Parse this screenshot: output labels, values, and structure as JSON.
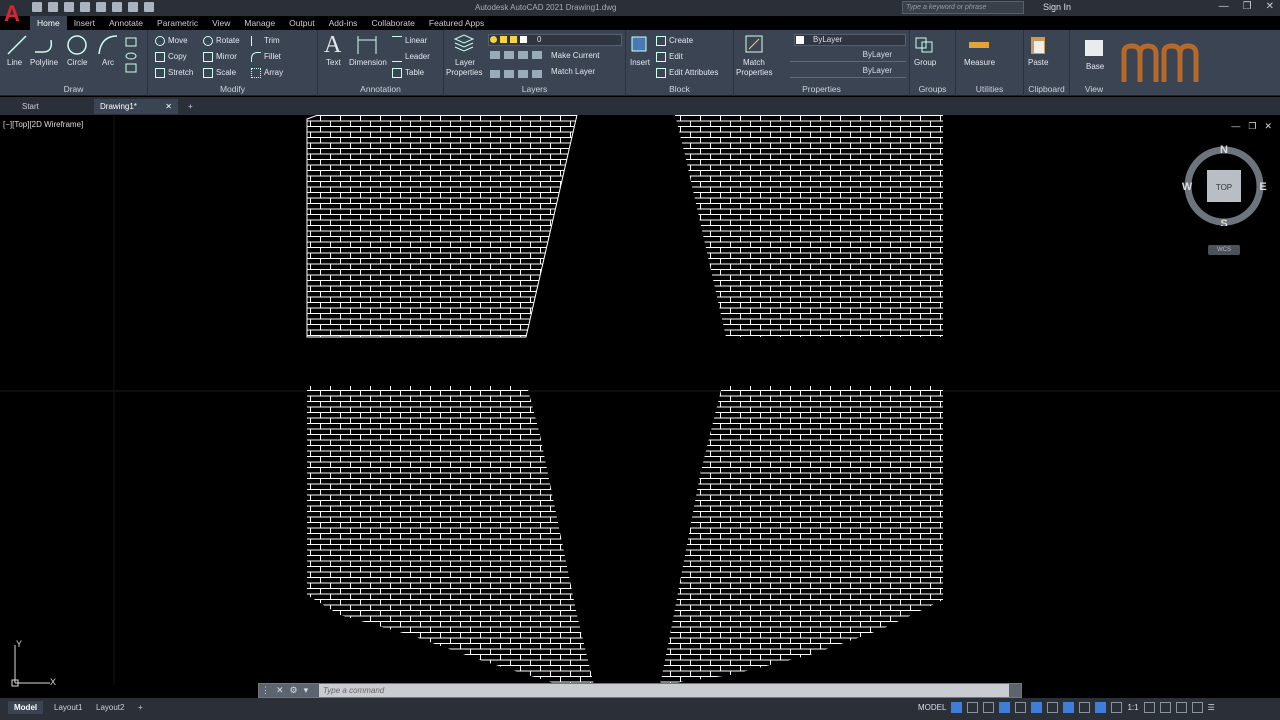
{
  "app": {
    "title": "Autodesk AutoCAD 2021    Drawing1.dwg",
    "search_placeholder": "Type a keyword or phrase",
    "signin": "Sign In",
    "logo_letter": "A"
  },
  "ribbon_tabs": [
    "Home",
    "Insert",
    "Annotate",
    "Parametric",
    "View",
    "Manage",
    "Output",
    "Add-ins",
    "Collaborate",
    "Featured Apps"
  ],
  "panels": {
    "draw": {
      "title": "Draw",
      "line": "Line",
      "polyline": "Polyline",
      "circle": "Circle",
      "arc": "Arc"
    },
    "modify": {
      "title": "Modify",
      "move": "Move",
      "rotate": "Rotate",
      "trim": "Trim",
      "copy": "Copy",
      "mirror": "Mirror",
      "fillet": "Fillet",
      "stretch": "Stretch",
      "scale": "Scale",
      "array": "Array"
    },
    "annotation": {
      "title": "Annotation",
      "text": "Text",
      "dimension": "Dimension",
      "linear": "Linear",
      "leader": "Leader",
      "table": "Table"
    },
    "layers": {
      "title": "Layers",
      "layer_properties_1": "Layer",
      "layer_properties_2": "Properties",
      "current_layer": "0",
      "make_current": "Make Current",
      "match_layer": "Match Layer"
    },
    "block": {
      "title": "Block",
      "insert": "Insert",
      "create": "Create",
      "edit": "Edit",
      "edit_attributes": "Edit Attributes"
    },
    "properties": {
      "title": "Properties",
      "match_1": "Match",
      "match_2": "Properties",
      "color": "ByLayer",
      "linetype": "ByLayer",
      "lineweight": "ByLayer"
    },
    "groups": {
      "title": "Groups",
      "group": "Group"
    },
    "utilities": {
      "title": "Utilities",
      "measure": "Measure"
    },
    "clipboard": {
      "title": "Clipboard",
      "paste": "Paste"
    },
    "view": {
      "title": "View",
      "base": "Base"
    }
  },
  "doc_tabs": [
    "Start",
    "Drawing1*"
  ],
  "viewport": {
    "label": "[−][Top][2D Wireframe]",
    "viewcube": {
      "n": "N",
      "s": "S",
      "e": "E",
      "w": "W",
      "face": "TOP"
    },
    "wcs": "WCS",
    "ucs_y": "Y",
    "ucs_x": "X"
  },
  "command": {
    "placeholder": "Type a command"
  },
  "status": {
    "layouts": [
      "Model",
      "Layout1",
      "Layout2"
    ],
    "model_label": "MODEL",
    "scale": "1:1"
  },
  "colors": {
    "ribbon": "#3b4453",
    "accent": "#3d7fd6",
    "brand_red": "#d9262c"
  }
}
